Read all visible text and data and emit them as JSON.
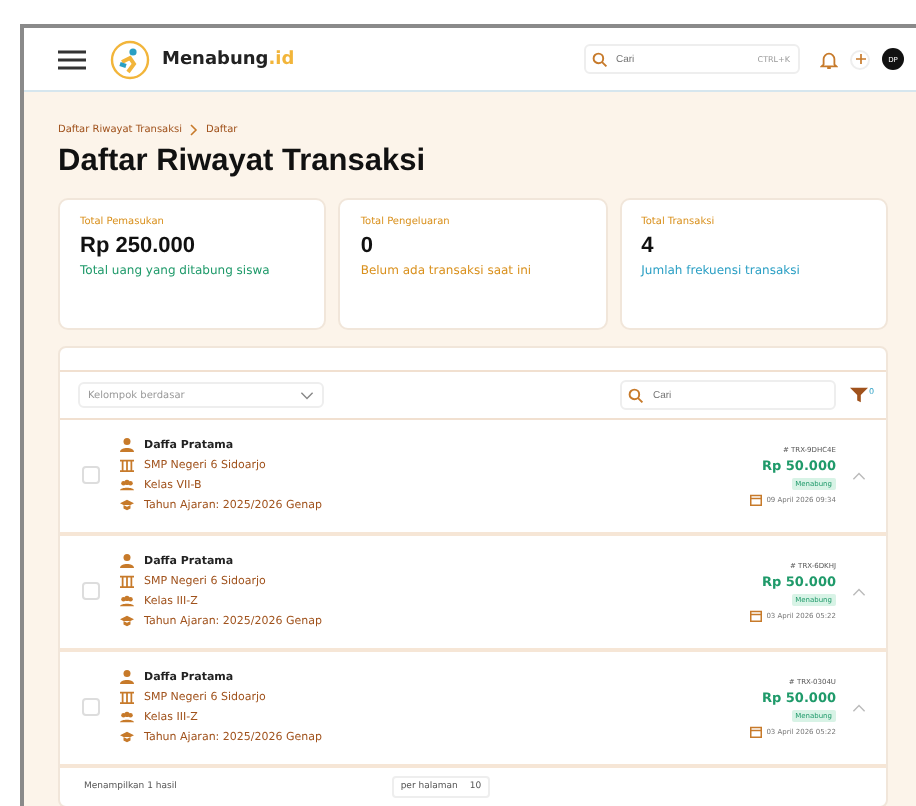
{
  "header": {
    "brand": "Menabung",
    "brand_suffix": ".id",
    "search": {
      "placeholder": "Cari",
      "shortcut": "CTRL+K"
    },
    "avatar": "DP"
  },
  "breadcrumb": [
    "Daftar Riwayat Transaksi",
    "Daftar"
  ],
  "title": "Daftar Riwayat Transaksi",
  "stats": [
    {
      "label": "Total Pemasukan",
      "value": "Rp 250.000",
      "note": "Total uang yang ditabung siswa",
      "color": "#1f9a6a"
    },
    {
      "label": "Total Pengeluaran",
      "value": "0",
      "note": "Belum ada transaksi saat ini",
      "color": "#d9901c"
    },
    {
      "label": "Total Transaksi",
      "value": "4",
      "note": "Jumlah frekuensi transaksi",
      "color": "#2a9fc4"
    }
  ],
  "toolbar": {
    "group_by": {
      "placeholder": "Kelompok berdasar"
    },
    "search": {
      "placeholder": "Cari"
    },
    "filter_count": "0"
  },
  "transactions": [
    {
      "name": "Daffa Pratama",
      "school": "SMP Negeri 6 Sidoarjo",
      "class": "Kelas VII-B",
      "year": "Tahun Ajaran: 2025/2026 Genap",
      "id": "# TRX-9DHC4E",
      "amount": "Rp 50.000",
      "type": "Menabung",
      "date": "09 April 2026 09:34",
      "checked": false
    },
    {
      "name": "Daffa Pratama",
      "school": "SMP Negeri 6 Sidoarjo",
      "class": "Kelas III-Z",
      "year": "Tahun Ajaran: 2025/2026 Genap",
      "id": "# TRX-6DKHJ",
      "amount": "Rp 50.000",
      "type": "Menabung",
      "date": "03 April 2026 05:22",
      "checked": false
    },
    {
      "name": "Daffa Pratama",
      "school": "SMP Negeri 6 Sidoarjo",
      "class": "Kelas III-Z",
      "year": "Tahun Ajaran: 2025/2026 Genap",
      "id": "# TRX-0304U",
      "amount": "Rp 50.000",
      "type": "Menabung",
      "date": "03 April 2026 05:22",
      "checked": false
    }
  ],
  "footer": {
    "summary": "Menampilkan 1 hasil",
    "per_page_label": "per halaman",
    "per_page": "10"
  }
}
